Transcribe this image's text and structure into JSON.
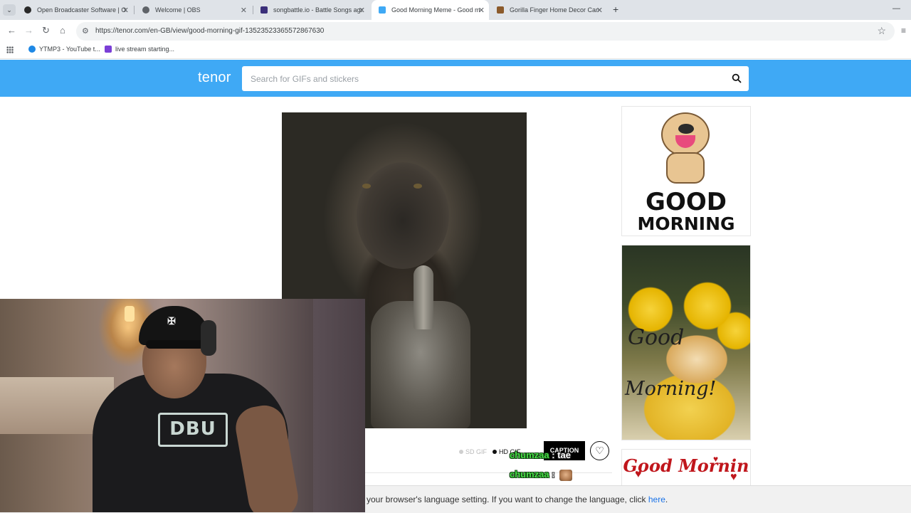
{
  "browser": {
    "tabs": [
      {
        "title": "Open Broadcaster Software | OBS",
        "active": false,
        "favicon_color": "#2a2a2a"
      },
      {
        "title": "Welcome | OBS",
        "active": false,
        "favicon_color": "#5f6368"
      },
      {
        "title": "songbattle.io - Battle Songs against",
        "active": false,
        "favicon_color": "#3b2f7a"
      },
      {
        "title": "Good Morning Meme - Good morning",
        "active": true,
        "favicon_color": "#3fa9f5"
      },
      {
        "title": "Gorilla Finger Home Decor Canvas",
        "active": false,
        "favicon_color": "#8b5a2b"
      }
    ],
    "new_tab_glyph": "+",
    "url": "https://tenor.com/en-GB/view/good-morning-gif-13523523365572867630",
    "bookmarks": [
      {
        "label": "YTMP3 - YouTube t...",
        "icon_color": "#1e88e5"
      },
      {
        "label": "live stream starting...",
        "icon_color": "#7b3fd6"
      }
    ]
  },
  "tenor": {
    "logo": "tenor",
    "search_placeholder": "Search for GIFs and stickers",
    "brand_color": "#3fa9f5"
  },
  "side_gifs": {
    "gif1_line1": "GOOD",
    "gif1_line2": "MORNING",
    "gif2_line1": "Good",
    "gif2_line2": "Morning!",
    "gif3_text": "Good Mornin"
  },
  "controls": {
    "sd_label": "SD GIF",
    "hd_label": "HD GIF",
    "hd_selected": true,
    "caption_label": "CAPTION",
    "favorite_glyph": "♡"
  },
  "chat": [
    {
      "user": "chumzaa",
      "message": ": tae"
    },
    {
      "user": "chumzaa",
      "message": ":"
    }
  ],
  "language_notice": {
    "text": "your browser's language setting. If you want to change the language, click ",
    "link": "here",
    "end": "."
  },
  "webcam": {
    "shirt_logo": "DBU"
  }
}
